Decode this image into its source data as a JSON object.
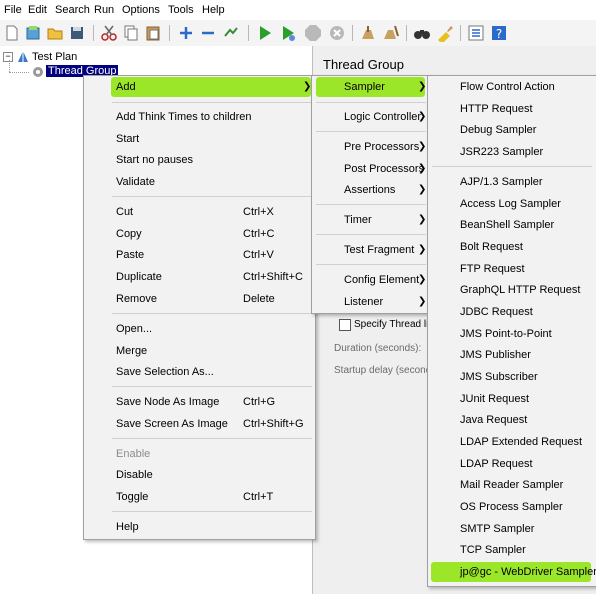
{
  "menubar": [
    "File",
    "Edit",
    "Search",
    "Run",
    "Options",
    "Tools",
    "Help"
  ],
  "tree": {
    "test_plan": "Test Plan",
    "thread_group": "Thread Group"
  },
  "panel": {
    "title": "Thread Group",
    "specify": "Specify Thread lifet",
    "duration": "Duration (seconds):",
    "startup": "Startup delay (seconds"
  },
  "context_menu": {
    "add": "Add",
    "add_think": "Add Think Times to children",
    "start": "Start",
    "start_no_pauses": "Start no pauses",
    "validate": "Validate",
    "cut": "Cut",
    "cut_sc": "Ctrl+X",
    "copy": "Copy",
    "copy_sc": "Ctrl+C",
    "paste": "Paste",
    "paste_sc": "Ctrl+V",
    "duplicate": "Duplicate",
    "duplicate_sc": "Ctrl+Shift+C",
    "remove": "Remove",
    "remove_sc": "Delete",
    "open": "Open...",
    "merge": "Merge",
    "save_selection": "Save Selection As...",
    "save_node": "Save Node As Image",
    "save_node_sc": "Ctrl+G",
    "save_screen": "Save Screen As Image",
    "save_screen_sc": "Ctrl+Shift+G",
    "enable": "Enable",
    "disable": "Disable",
    "toggle": "Toggle",
    "toggle_sc": "Ctrl+T",
    "help": "Help"
  },
  "add_menu": {
    "sampler": "Sampler",
    "logic_controller": "Logic Controller",
    "pre_processors": "Pre Processors",
    "post_processors": "Post Processors",
    "assertions": "Assertions",
    "timer": "Timer",
    "test_fragment": "Test Fragment",
    "config_element": "Config Element",
    "listener": "Listener"
  },
  "sampler_menu": {
    "flow_control_action": "Flow Control Action",
    "http_request": "HTTP Request",
    "debug_sampler": "Debug Sampler",
    "jsr223_sampler": "JSR223 Sampler",
    "ajp_sampler": "AJP/1.3 Sampler",
    "access_log_sampler": "Access Log Sampler",
    "beanshell_sampler": "BeanShell Sampler",
    "bolt_request": "Bolt Request",
    "ftp_request": "FTP Request",
    "graphql_http_request": "GraphQL HTTP Request",
    "jdbc_request": "JDBC Request",
    "jms_point_to_point": "JMS Point-to-Point",
    "jms_publisher": "JMS Publisher",
    "jms_subscriber": "JMS Subscriber",
    "junit_request": "JUnit Request",
    "java_request": "Java Request",
    "ldap_extended_request": "LDAP Extended Request",
    "ldap_request": "LDAP Request",
    "mail_reader_sampler": "Mail Reader Sampler",
    "os_process_sampler": "OS Process Sampler",
    "smtp_sampler": "SMTP Sampler",
    "tcp_sampler": "TCP Sampler",
    "webdriver_sampler": "jp@gc - WebDriver Sampler"
  },
  "colors": {
    "highlight": "#9ce62a",
    "menu_bg": "#f2f2f2",
    "selection": "#000080"
  }
}
